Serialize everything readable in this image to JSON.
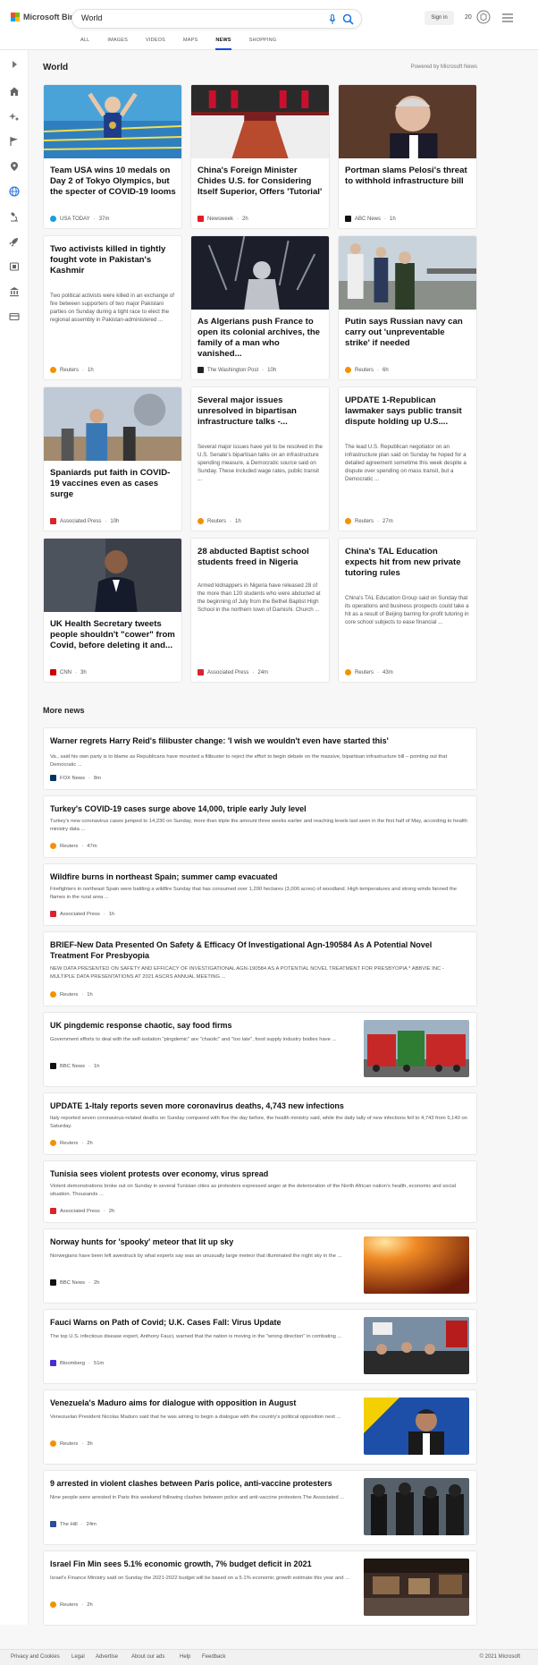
{
  "header": {
    "logo_text": "Microsoft Bing",
    "search_value": "World",
    "signin_label": "Sign in",
    "rewards_count": "20"
  },
  "nav": [
    "ALL",
    "IMAGES",
    "VIDEOS",
    "MAPS",
    "NEWS",
    "SHOPPING"
  ],
  "nav_active": "NEWS",
  "section": {
    "title": "World",
    "powered": "Powered by Microsoft News"
  },
  "cards": [
    {
      "title": "Team USA wins 10 medals on Day 2 of Tokyo Olympics, but the specter of COVID-19 looms",
      "source": "USA TODAY",
      "time": "37m",
      "logo_color": "#1a9be6",
      "snippet": ""
    },
    {
      "title": "China's Foreign Minister Chides U.S. for Considering Itself Superior, Offers 'Tutorial'",
      "source": "Newsweek",
      "time": "2h",
      "logo_color": "#e31b23",
      "snippet": ""
    },
    {
      "title": "Portman slams Pelosi's threat to withhold infrastructure bill",
      "source": "ABC News",
      "time": "1h",
      "logo_color": "#111111",
      "snippet": ""
    },
    {
      "title": "Two activists killed in tightly fought vote in Pakistan's Kashmir",
      "source": "Reuters",
      "time": "1h",
      "logo_color": "#f39200",
      "snippet": "Two political activists were killed in an exchange of fire between supporters of two major Pakistani parties on Sunday during a tight race to elect the regional assembly in Pakistan-administered ..."
    },
    {
      "title": "As Algerians push France to open its colonial archives, the family of a man who vanished...",
      "source": "The Washington Post",
      "time": "10h",
      "logo_color": "#222222",
      "snippet": ""
    },
    {
      "title": "Putin says Russian navy can carry out 'unpreventable strike' if needed",
      "source": "Reuters",
      "time": "6h",
      "logo_color": "#f39200",
      "snippet": ""
    },
    {
      "title": "Spaniards put faith in COVID-19 vaccines even as cases surge",
      "source": "Associated Press",
      "time": "10h",
      "logo_color": "#d9232d",
      "snippet": ""
    },
    {
      "title": "Several major issues unresolved in bipartisan infrastructure talks -...",
      "source": "Reuters",
      "time": "1h",
      "logo_color": "#f39200",
      "snippet": "Several major issues have yet to be resolved in the U.S. Senate's bipartisan talks on an infrastructure spending measure, a Democratic source said on Sunday. These included wage rates, public transit ..."
    },
    {
      "title": "UPDATE 1-Republican lawmaker says public transit dispute holding up U.S....",
      "source": "Reuters",
      "time": "27m",
      "logo_color": "#f39200",
      "snippet": "The lead U.S. Republican negotiator on an infrastructure plan said on Sunday he hoped for a detailed agreement sometime this week despite a dispute over spending on mass transit, but a Democratic ..."
    },
    {
      "title": "UK Health Secretary tweets people shouldn't \"cower\" from Covid, before deleting it and...",
      "source": "CNN",
      "time": "3h",
      "logo_color": "#cc0000",
      "snippet": ""
    },
    {
      "title": "28 abducted Baptist school students freed in Nigeria",
      "source": "Associated Press",
      "time": "24m",
      "logo_color": "#d9232d",
      "snippet": "Armed kidnappers in Nigeria have released 28 of the more than 120 students who were abducted at the beginning of July from the Bethel Baptist High School in the northern town of Damishi. Church ..."
    },
    {
      "title": "China's TAL Education expects hit from new private tutoring rules",
      "source": "Reuters",
      "time": "43m",
      "logo_color": "#f39200",
      "snippet": "China's TAL Education Group said on Sunday that its operations and business prospects could take a hit as a result of Beijing barring for-profit tutoring in core school subjects to ease financial ..."
    }
  ],
  "more": {
    "title": "More news",
    "items": [
      {
        "title": "Warner regrets Harry Reid's filibuster change: 'I wish we wouldn't even have started this'",
        "snippet": "Va., said his own party is to blame as Republicans have mounted a filibuster to reject the effort to begin debate on the massive, bipartisan infrastructure bill – pointing out that Democratic ...",
        "source": "FOX News",
        "time": "8m",
        "logo_color": "#003366"
      },
      {
        "title": "Turkey's COVID-19 cases surge above 14,000, triple early July level",
        "snippet": "Turkey's new coronavirus cases jumped to 14,230 on Sunday, more than triple the amount three weeks earlier and reaching levels last seen in the first half of May, according to health ministry data ...",
        "source": "Reuters",
        "time": "47m",
        "logo_color": "#f39200"
      },
      {
        "title": "Wildfire burns in northeast Spain; summer camp evacuated",
        "snippet": "Firefighters in northeast Spain were battling a wildfire Sunday that has consumed over 1,200 hectares (3,000 acres) of woodland. High temperatures and strong winds fanned the flames in the rural area ...",
        "source": "Associated Press",
        "time": "1h",
        "logo_color": "#d9232d"
      },
      {
        "title": "BRIEF-New Data Presented On Safety & Efficacy Of Investigational Agn-190584 As A Potential Novel Treatment For Presbyopia",
        "snippet": "NEW DATA PRESENTED ON SAFETY AND EFFICACY OF INVESTIGATIONAL AGN-190584 AS A POTENTIAL NOVEL TREATMENT FOR PRESBYOPIA * ABBVIE INC - MULTIPLE DATA PRESENTATIONS AT 2021 ASCRS ANNUAL MEETING ...",
        "source": "Reuters",
        "time": "1h",
        "logo_color": "#f39200"
      },
      {
        "title": "UK pingdemic response chaotic, say food firms",
        "snippet": "Government efforts to deal with the self-isolation \"pingdemic\" are \"chaotic\" and \"too late\", food supply industry bodies have ...",
        "source": "BBC News",
        "time": "1h",
        "logo_color": "#111111"
      },
      {
        "title": "UPDATE 1-Italy reports seven more coronavirus deaths, 4,743 new infections",
        "snippet": "Italy reported seven coronavirus-related deaths on Sunday compared with five the day before, the health ministry said, while the daily tally of new infections fell to 4,743 from 5,140 on Saturday.",
        "source": "Reuters",
        "time": "2h",
        "logo_color": "#f39200"
      },
      {
        "title": "Tunisia sees violent protests over economy, virus spread",
        "snippet": "Violent demonstrations broke out on Sunday in several Tunisian cities as protesters expressed anger at the deterioration of the North African nation's health, economic and social situation. Thousands ...",
        "source": "Associated Press",
        "time": "2h",
        "logo_color": "#d9232d"
      },
      {
        "title": "Norway hunts for 'spooky' meteor that lit up sky",
        "snippet": "Norwegians have been left awestruck by what experts say was an unusually large meteor that illuminated the night sky in the ...",
        "source": "BBC News",
        "time": "2h",
        "logo_color": "#111111"
      },
      {
        "title": "Fauci Warns on Path of Covid; U.K. Cases Fall: Virus Update",
        "snippet": "The top U.S. infectious disease expert, Anthony Fauci, warned that the nation is moving in the \"wrong direction\" in combating ...",
        "source": "Bloomberg",
        "time": "51m",
        "logo_color": "#4a2cd3"
      },
      {
        "title": "Venezuela's Maduro aims for dialogue with opposition in August",
        "snippet": "Venezuelan President Nicolas Maduro said that he was aiming to begin a dialogue with the country's political opposition next ...",
        "source": "Reuters",
        "time": "3h",
        "logo_color": "#f39200"
      },
      {
        "title": "9 arrested in violent clashes between Paris police, anti-vaccine protesters",
        "snippet": "Nine people were arrested in Paris this weekend following clashes between police and anti-vaccine protesters.The Associated ...",
        "source": "The Hill",
        "time": "24m",
        "logo_color": "#2b4b9b"
      },
      {
        "title": "Israel Fin Min sees 5.1% economic growth, 7% budget deficit in 2021",
        "snippet": "Israel's Finance Ministry said on Sunday the 2021-2022 budget will be based on a 5.1% economic growth estimate this year and ...",
        "source": "Reuters",
        "time": "2h",
        "logo_color": "#f39200"
      }
    ]
  },
  "footer": {
    "links": [
      "Privacy and Cookies",
      "Legal",
      "Advertise",
      "About our ads",
      "Help",
      "Feedback"
    ],
    "copyright": "© 2021 Microsoft"
  }
}
